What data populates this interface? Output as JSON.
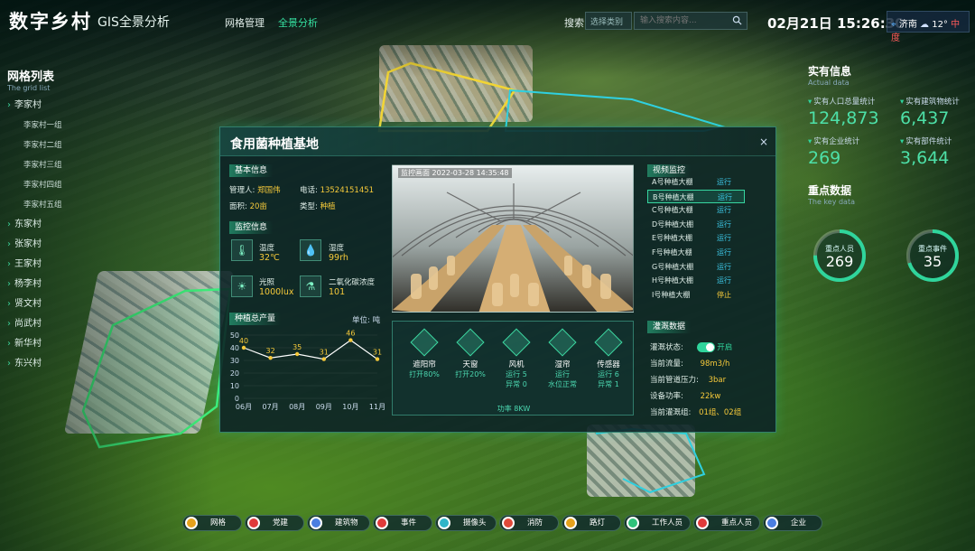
{
  "header": {
    "logo": "数字乡村",
    "subtitle": "GIS全景分析",
    "nav": [
      "网格管理",
      "全景分析"
    ],
    "search_label": "搜索",
    "search_select": "选择类别",
    "search_placeholder": "输入搜索内容...",
    "datetime": "02月21日 15:26:30",
    "city": "济南",
    "temp": "12°",
    "aqi": "中度"
  },
  "grid_list": {
    "title": "网格列表",
    "subtitle": "The grid list",
    "items": [
      {
        "label": "李家村",
        "level": "top"
      },
      {
        "label": "李家村一组",
        "level": "sub"
      },
      {
        "label": "李家村二组",
        "level": "sub"
      },
      {
        "label": "李家村三组",
        "level": "sub"
      },
      {
        "label": "李家村四组",
        "level": "sub"
      },
      {
        "label": "李家村五组",
        "level": "sub"
      },
      {
        "label": "东家村",
        "level": "top"
      },
      {
        "label": "张家村",
        "level": "top"
      },
      {
        "label": "王家村",
        "level": "top"
      },
      {
        "label": "杨李村",
        "level": "top"
      },
      {
        "label": "贤文村",
        "level": "top"
      },
      {
        "label": "尚武村",
        "level": "top"
      },
      {
        "label": "新华村",
        "level": "top"
      },
      {
        "label": "东兴村",
        "level": "top"
      }
    ]
  },
  "real_info": {
    "title": "实有信息",
    "subtitle": "Actual data",
    "stats": [
      {
        "label": "实有人口总量统计",
        "value": "124,873"
      },
      {
        "label": "实有建筑物统计",
        "value": "6,437"
      },
      {
        "label": "实有企业统计",
        "value": "269"
      },
      {
        "label": "实有部件统计",
        "value": "3,644"
      }
    ]
  },
  "key_data": {
    "title": "重点数据",
    "subtitle": "The key data",
    "rings": [
      {
        "label": "重点人员",
        "value": "269",
        "percent": 75
      },
      {
        "label": "重点事件",
        "value": "35",
        "percent": 70
      }
    ]
  },
  "modal": {
    "title": "食用菌种植基地",
    "close": "×",
    "basic": {
      "tag": "基本信息",
      "manager_label": "管理人:",
      "manager": "郑国伟",
      "phone_label": "电话:",
      "phone": "13524151451",
      "area_label": "面积:",
      "area": "20亩",
      "type_label": "类型:",
      "type": "种植"
    },
    "monitor": {
      "tag": "监控信息",
      "items": [
        {
          "label": "温度",
          "value": "32℃",
          "icon": "thermometer-icon"
        },
        {
          "label": "湿度",
          "value": "99rh",
          "icon": "droplet-icon"
        },
        {
          "label": "光照",
          "value": "1000lux",
          "icon": "sun-icon"
        },
        {
          "label": "二氧化碳浓度",
          "value": "101",
          "icon": "flask-icon"
        }
      ]
    },
    "production": {
      "tag": "种植总产量",
      "unit": "单位: 吨"
    },
    "photo_caption": "监控画面",
    "photo_time": "2022-03-28  14:35:48",
    "devices": [
      {
        "name": "遮阳帘",
        "status": [
          "打开80%"
        ]
      },
      {
        "name": "天窗",
        "status": [
          "打开20%"
        ]
      },
      {
        "name": "风机",
        "status": [
          "运行 5",
          "异常 0"
        ]
      },
      {
        "name": "湿帘",
        "status": [
          "运行",
          "水位正常"
        ]
      },
      {
        "name": "传感器",
        "status": [
          "运行 6",
          "异常 1"
        ]
      }
    ],
    "device_power": "功率 8KW",
    "video": {
      "tag": "视频监控",
      "rows": [
        {
          "name": "A号种植大棚",
          "status": "运行"
        },
        {
          "name": "B号种植大棚",
          "status": "运行",
          "selected": true
        },
        {
          "name": "C号种植大棚",
          "status": "运行"
        },
        {
          "name": "D号种植大棚",
          "status": "运行"
        },
        {
          "name": "E号种植大棚",
          "status": "运行"
        },
        {
          "name": "F号种植大棚",
          "status": "运行"
        },
        {
          "name": "G号种植大棚",
          "status": "运行"
        },
        {
          "name": "H号种植大棚",
          "status": "运行"
        },
        {
          "name": "I号种植大棚",
          "status": "停止"
        }
      ]
    },
    "irrigation": {
      "tag": "灌溉数据",
      "rows": [
        {
          "label": "灌溉状态:",
          "value": "开启"
        },
        {
          "label": "当前流量:",
          "value": "98m3/h"
        },
        {
          "label": "当前管道压力:",
          "value": "3bar"
        },
        {
          "label": "设备功率:",
          "value": "22kw"
        },
        {
          "label": "当前灌溉组:",
          "value": "01组、02组"
        }
      ]
    }
  },
  "chart_data": {
    "type": "line",
    "x": [
      "06月",
      "07月",
      "08月",
      "09月",
      "10月",
      "11月"
    ],
    "values": [
      40,
      32,
      35,
      31,
      46,
      31
    ],
    "ylim": [
      0,
      50
    ],
    "yticks": [
      0,
      10,
      20,
      30,
      40,
      50
    ],
    "color": "#ffffff",
    "marker_color": "#f5c93a"
  },
  "bottom_bar": [
    {
      "label": "网格",
      "color": "#e6a21c"
    },
    {
      "label": "党建",
      "color": "#e03a3a"
    },
    {
      "label": "建筑物",
      "color": "#4a7ee0"
    },
    {
      "label": "事件",
      "color": "#e03a3a"
    },
    {
      "label": "摄像头",
      "color": "#2fb5c8"
    },
    {
      "label": "消防",
      "color": "#e04a3a"
    },
    {
      "label": "路灯",
      "color": "#e6a21c"
    },
    {
      "label": "工作人员",
      "color": "#2fc27a"
    },
    {
      "label": "重点人员",
      "color": "#e03a3a"
    },
    {
      "label": "企业",
      "color": "#4a7ee0"
    }
  ]
}
